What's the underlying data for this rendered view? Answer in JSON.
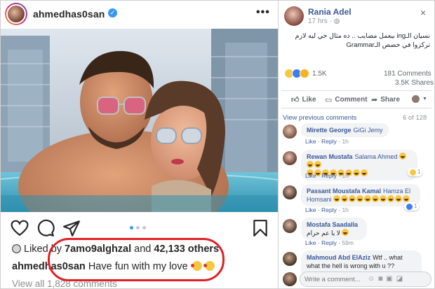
{
  "instagram": {
    "username": "ahmedhas0san",
    "verified_icon": "verified-badge-icon",
    "more_icon": "more-dots-icon",
    "more_glyph": "•••",
    "actions": [
      "heart-icon",
      "comment-icon",
      "share-icon",
      "bookmark-icon"
    ],
    "carousel": {
      "count": 3,
      "active": 1
    },
    "likes_prefix": "Liked by",
    "likes_user": "7amo9alghzal",
    "likes_and": "and",
    "likes_others": "42,133 others",
    "caption_user": "ahmedhas0san",
    "caption_text": "Have fun with my love",
    "view_all": "View all 1,828 comments",
    "annotation_color": "#e21f26"
  },
  "facebook": {
    "author": "Rania Adel",
    "time": "17 hrs",
    "privacy_icon": "globe-icon",
    "close_glyph": "×",
    "post_text": "نسيان الـing بيعمل مصايب .. ده مثال حي ليه لازم تركزوا في حصص الـGrammar",
    "reactions": [
      "haha",
      "like",
      "sad"
    ],
    "reactions_count": "1.5K",
    "comments_count": "181 Comments",
    "shares_count": "3.5K Shares",
    "actions": {
      "like": "Like",
      "comment": "Comment",
      "share": "Share"
    },
    "view_previous": "View previous comments",
    "page_count": "6 of 128",
    "comments": [
      {
        "name": "Mirette George",
        "text": "GiGi Jemy",
        "meta": [
          "Like",
          "Reply",
          "1h"
        ]
      },
      {
        "name": "Rewan Mustafa",
        "text": "Salama Ahmed",
        "laughs": 11,
        "meta": [
          "Like",
          "Reply",
          "1h"
        ],
        "reactions": "1"
      },
      {
        "name": "Passant Moustafa Kamal",
        "text": "Hamza El Homsani",
        "laughs": 10,
        "meta": [
          "Like",
          "Reply",
          "1h"
        ],
        "reactions": "1"
      },
      {
        "name": "Mostafa Saadalla",
        "text": "لا يا عم حرام",
        "laughs": 1,
        "meta": [
          "Like",
          "Reply",
          "59m"
        ]
      },
      {
        "name": "Mahmoud Abd ElAziz",
        "text": "Wtf .. what what the hell is wrong with u ?? @Ahmed Hassan"
      }
    ],
    "comment_placeholder": "Write a comment..."
  },
  "colors": {
    "fb_link": "#385898",
    "ig_text": "#262626",
    "ig_accent": "#3897f0"
  }
}
